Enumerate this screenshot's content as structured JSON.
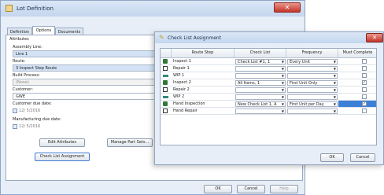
{
  "main_window": {
    "title": "Lot Definition",
    "close_glyph": "✕",
    "tabs": [
      {
        "label": "Definition",
        "active": false
      },
      {
        "label": "Options",
        "active": true
      },
      {
        "label": "Documents",
        "active": false
      }
    ],
    "section_title": "Attributes",
    "assembly_line_label": "Assembly Line:",
    "assembly_line_value": "Line 1",
    "route_label": "Route:",
    "route_value": "3 Inspect Step Route",
    "build_process_label": "Build Process:",
    "build_process_value": "(None)",
    "customer_label": "Customer:",
    "customer_value": "GWE",
    "customer_due_label": "Customer due date:",
    "customer_due_value": "12/ 5/2016",
    "manufacturing_due_label": "Manufacturing due date:",
    "manufacturing_due_value": "12/ 5/2016",
    "edit_attributes_label": "Edit Attributes",
    "manage_part_sets_label": "Manage Part Sets...",
    "check_list_assignment_label": "Check List Assignment",
    "ok_label": "OK",
    "cancel_label": "Cancel",
    "help_label": "Help"
  },
  "dialog": {
    "title": "Check List Assignment",
    "close_glyph": "✕",
    "columns": [
      "Route Step",
      "Check List",
      "Frequency",
      "Must Complete"
    ],
    "rows": [
      {
        "icon": "inspect-icon",
        "step": "Inspect 1",
        "check_list": "Check List #1, 1",
        "frequency": "Every Unit",
        "must_complete": false
      },
      {
        "icon": "repair-icon",
        "step": "Repair 1",
        "check_list": "",
        "frequency": "",
        "must_complete": false
      },
      {
        "icon": "wip-icon",
        "step": "WIP 1",
        "check_list": "",
        "frequency": "",
        "must_complete": false
      },
      {
        "icon": "inspect-icon",
        "step": "Inspect 2",
        "check_list": "All Items, 1",
        "frequency": "First Unit Only",
        "must_complete": true
      },
      {
        "icon": "repair-icon",
        "step": "Repair 2",
        "check_list": "",
        "frequency": "",
        "must_complete": false
      },
      {
        "icon": "wip-icon",
        "step": "WIP 2",
        "check_list": "",
        "frequency": "",
        "must_complete": false
      },
      {
        "icon": "inspect-icon",
        "step": "Hand Inspection",
        "check_list": "New Check List 1, A",
        "frequency": "First Unit per Day",
        "must_complete": true,
        "selected": true
      },
      {
        "icon": "repair-icon",
        "step": "Hand Repair",
        "check_list": "",
        "frequency": "",
        "must_complete": false
      }
    ],
    "ok_label": "OK",
    "cancel_label": "Cancel",
    "checkmark": "✓",
    "dropdown_glyph": "▼"
  }
}
